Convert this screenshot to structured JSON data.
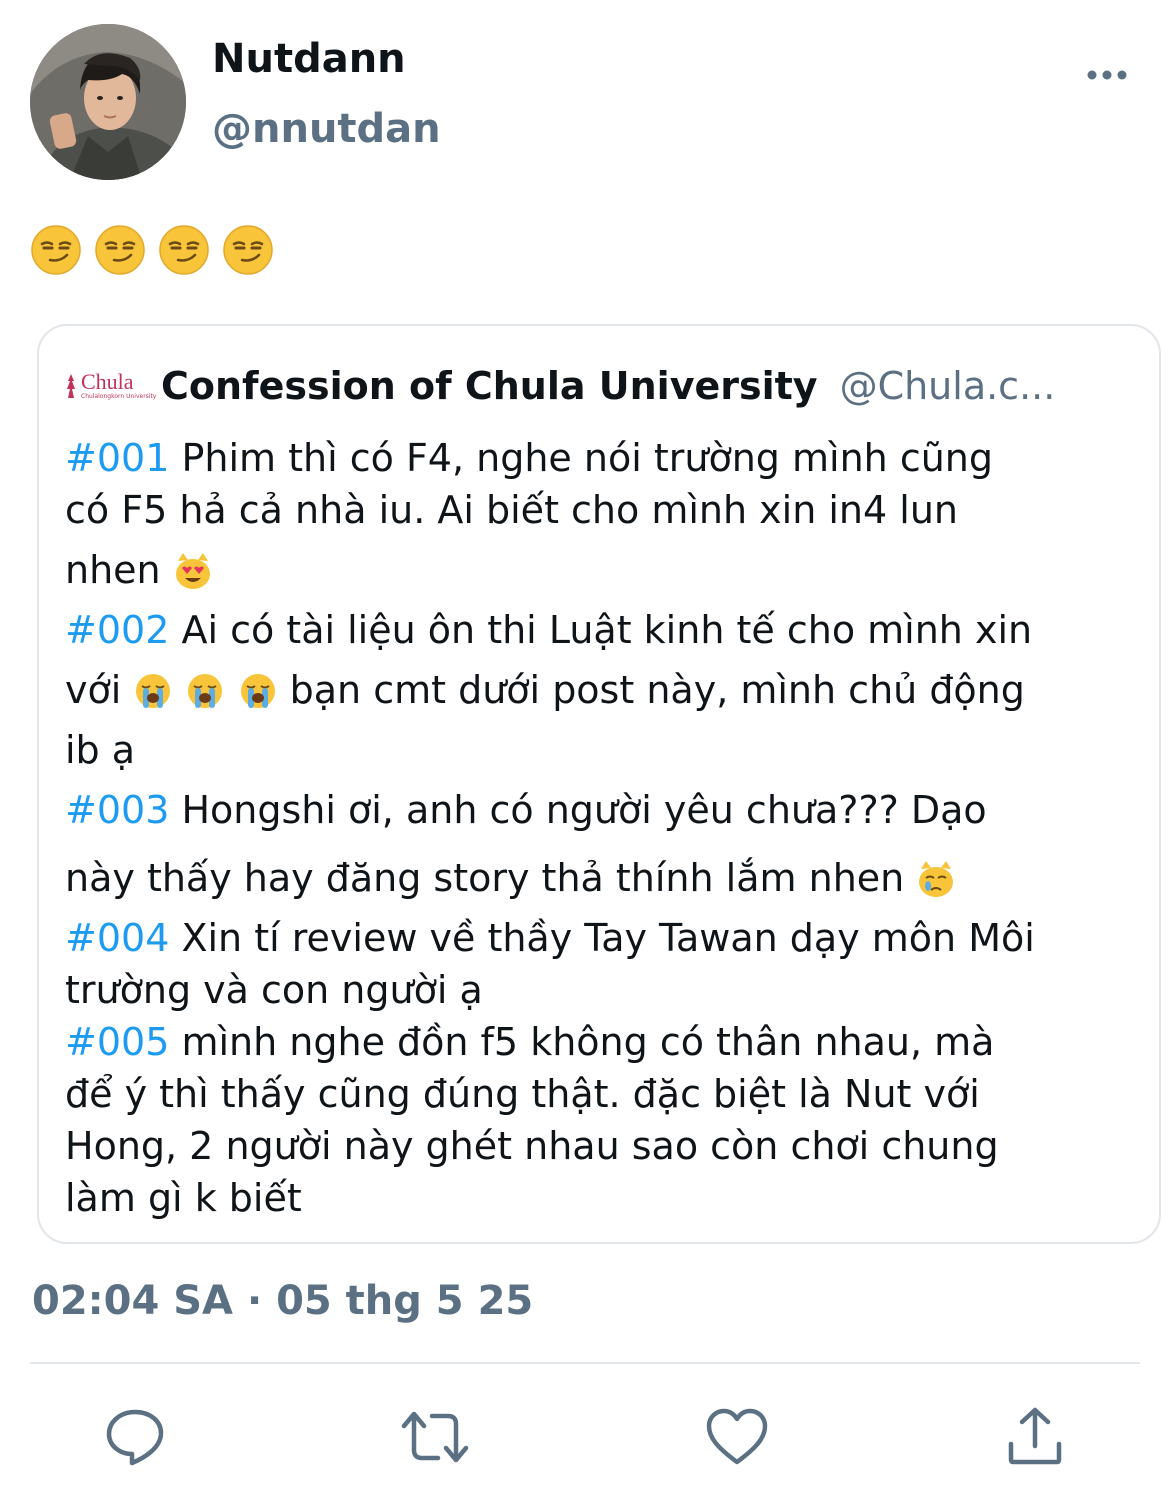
{
  "author": {
    "display_name": "Nutdann",
    "handle": "@nnutdan"
  },
  "tweet": {
    "emojis": [
      "😏",
      "😏",
      "😏",
      "😏"
    ]
  },
  "quoted": {
    "logo_text": "Chula",
    "logo_subtext": "Chulalongkorn University",
    "name": "Confession of Chula University",
    "handle": "@Chula.c...",
    "posts": [
      {
        "tag": "#001",
        "line1": " Phim thì có F4, nghe nói trường mình cũng",
        "line2": "có F5 hả cả nhà iu. Ai biết cho mình xin in4 lun",
        "line3": "nhen ",
        "emoji": "😻"
      },
      {
        "tag": "#002",
        "line1": " Ai có tài liệu ôn thi Luật kinh tế cho mình xin",
        "line2_start": "với ",
        "emojis": [
          "😭",
          "😭",
          "😭"
        ],
        "line2_end": "  bạn cmt dưới post này, mình chủ động",
        "line3": "ib ạ"
      },
      {
        "tag": "#003",
        "line1": " Hongshi ơi, anh có người yêu chưa??? Dạo",
        "line2": "này thấy hay đăng story thả thính lắm nhen ",
        "emoji": "😿"
      },
      {
        "tag": "#004",
        "line1": " Xin tí review về thầy Tay Tawan dạy môn Môi",
        "line2": "trường và con người ạ"
      },
      {
        "tag": "#005",
        "line1": " mình nghe đồn f5 không có thân nhau, mà",
        "line2": "để ý thì thấy cũng đúng thật. đặc biệt là Nut với",
        "line3": "Hong, 2 người này ghét nhau sao còn chơi chung",
        "line4": "làm gì k biết"
      }
    ]
  },
  "timestamp": "02:04 SA · 05 thg 5 25",
  "actions": {
    "icons": [
      "reply-icon",
      "retweet-icon",
      "like-icon",
      "share-icon"
    ]
  },
  "colors": {
    "hashtag": "#1d9bf0",
    "secondary_text": "#5b7083",
    "border": "#e1e6eb"
  }
}
